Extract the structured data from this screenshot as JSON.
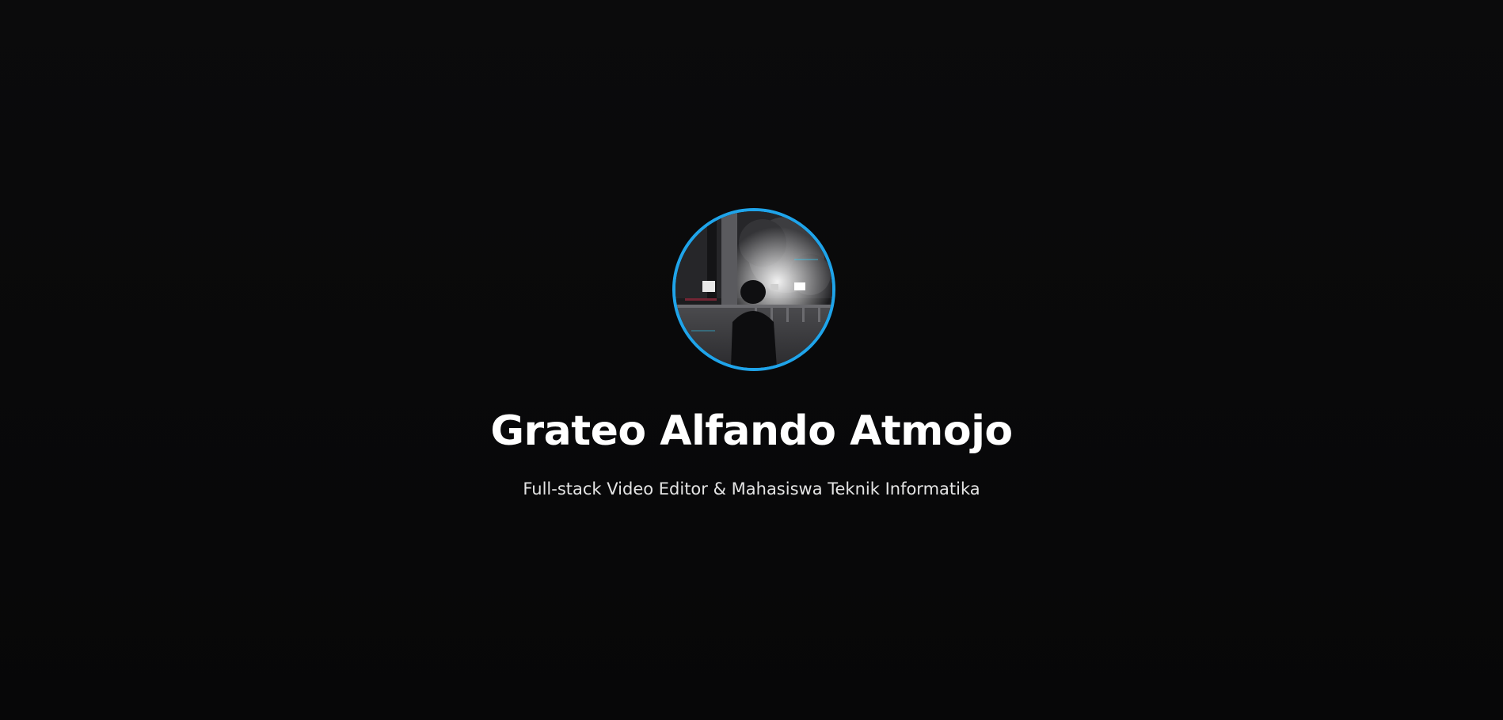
{
  "profile": {
    "name": "Grateo Alfando Atmojo",
    "tagline": "Full-stack Video Editor & Mahasiswa Teknik Informatika",
    "avatar_icon": "profile-photo",
    "accent_color": "#1fa4ea"
  },
  "theme": {
    "background": "#0a0a0b",
    "text": "#ffffff"
  }
}
